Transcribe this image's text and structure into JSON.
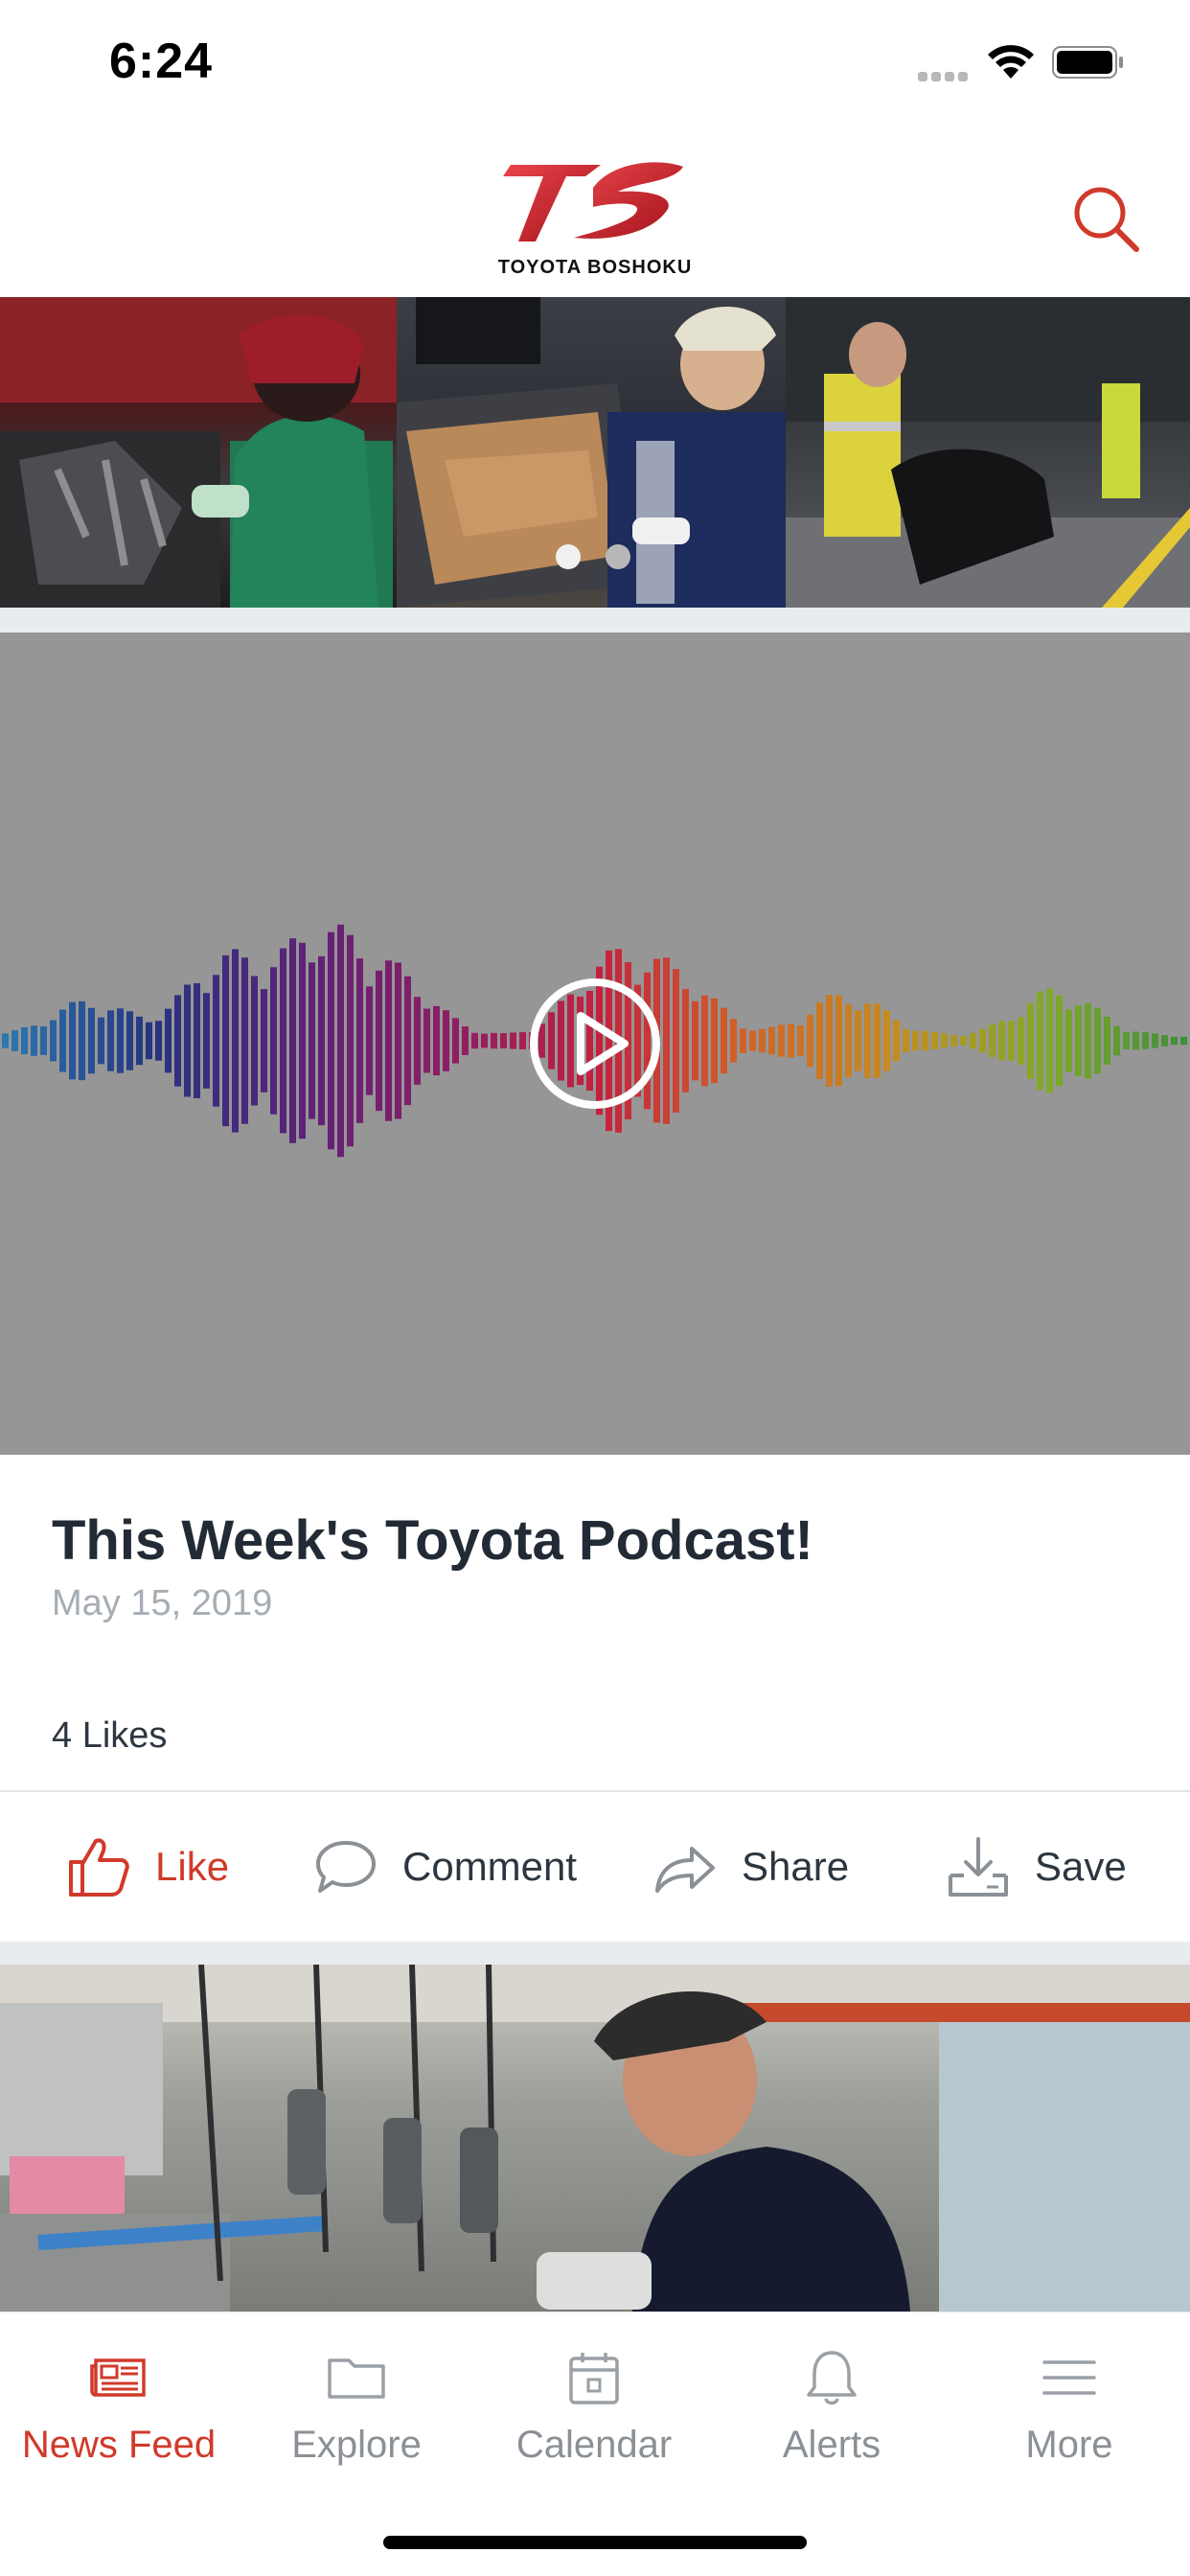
{
  "status_bar": {
    "time": "6:24",
    "icons": [
      "cellular-dots-icon",
      "wifi-icon",
      "battery-icon"
    ]
  },
  "header": {
    "logo_text": "TOYOTA BOSHOKU",
    "search_icon": "search-icon",
    "accent_color": "#d03a2a"
  },
  "carousel": {
    "slides": [
      "factory-welder",
      "car-door-assembly",
      "bumper-inspection"
    ],
    "page_count": 2,
    "active_page": 1
  },
  "post": {
    "media_type": "audio-waveform",
    "title": "This Week's Toyota Podcast!",
    "date": "May 15, 2019",
    "likes": "4 Likes"
  },
  "actions": {
    "like": "Like",
    "comment": "Comment",
    "share": "Share",
    "save": "Save"
  },
  "tabbar": {
    "tabs": [
      {
        "label": "News Feed",
        "icon": "newspaper-icon",
        "active": true
      },
      {
        "label": "Explore",
        "icon": "folder-icon",
        "active": false
      },
      {
        "label": "Calendar",
        "icon": "calendar-icon",
        "active": false
      },
      {
        "label": "Alerts",
        "icon": "bell-icon",
        "active": false
      },
      {
        "label": "More",
        "icon": "menu-icon",
        "active": false
      }
    ]
  }
}
